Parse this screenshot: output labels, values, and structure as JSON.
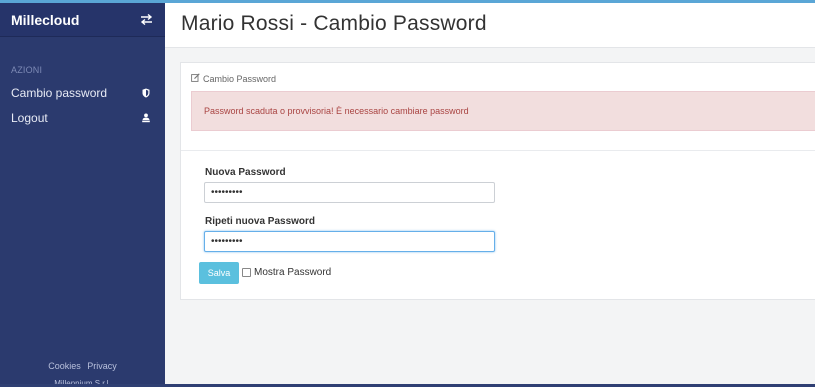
{
  "sidebar": {
    "app_name": "Millecloud",
    "section_label": "AZIONI",
    "items": [
      {
        "label": "Cambio password",
        "icon": "shield-icon"
      },
      {
        "label": "Logout",
        "icon": "users-icon"
      }
    ],
    "footer": {
      "links": [
        "Cookies",
        "Privacy"
      ],
      "copyright": "Millennium S.r.l."
    }
  },
  "header": {
    "title": "Mario Rossi - Cambio Password"
  },
  "panel": {
    "heading": "Cambio Password",
    "alert": "Password scaduta o provvisoria! È necessario cambiare password"
  },
  "form": {
    "new_password_label": "Nuova Password",
    "new_password_value": "•••••••••",
    "repeat_password_label": "Ripeti nuova Password",
    "repeat_password_value": "•••••••••",
    "save_label": "Salva",
    "show_password_label": "Mostra Password"
  },
  "colors": {
    "sidebar_bg": "#2b3a6e",
    "alert_bg": "#f2dede",
    "alert_text": "#a94442",
    "button_bg": "#5bc0de",
    "focus_border": "#66afe9"
  }
}
